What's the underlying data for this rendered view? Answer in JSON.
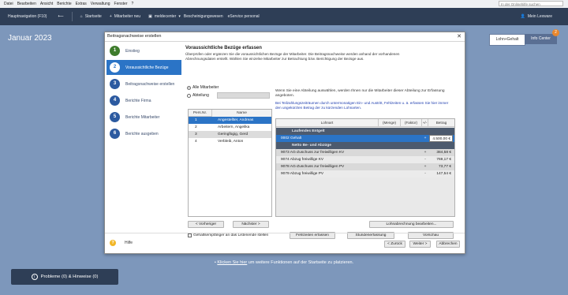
{
  "menu": [
    "Datei",
    "Bearbeiten",
    "Ansicht",
    "Berichte",
    "Extras",
    "Verwaltung",
    "Fenster",
    "?"
  ],
  "search_placeholder": "In der Onlinehilfe suchen",
  "nav": {
    "hauptnavigation": "Hauptnavigation (F10)",
    "startseite": "Startseite",
    "mitarbeiter_neu": "Mitarbeiter neu",
    "meldecenter": "meldecenter",
    "bescheinigungswesen": "Bescheinigungswesen",
    "eservice": "eService personal",
    "mein_lexware": "Mein Lexware"
  },
  "page": {
    "title": "Januar 2023",
    "tab_lohn": "Lohn+Gehalt",
    "tab_info": "Info Center",
    "info_badge": "2"
  },
  "dialog": {
    "title": "Beitragsnachweise erstellen",
    "steps": [
      {
        "num": "1",
        "label": "Einstieg",
        "state": "done"
      },
      {
        "num": "2",
        "label": "Voraussichtliche Bezüge",
        "state": "active"
      },
      {
        "num": "3",
        "label": "Beitragsnachweise erstellen",
        "state": "todo"
      },
      {
        "num": "4",
        "label": "Berichte Firma",
        "state": "todo"
      },
      {
        "num": "5",
        "label": "Berichte Mitarbeiter",
        "state": "todo"
      },
      {
        "num": "6",
        "label": "Berichte ausgeben",
        "state": "todo"
      }
    ],
    "heading": "Voraussichtliche Bezüge erfassen",
    "intro": "Überprüfen oder ergänzen Sie die voraussichtlichen Bezüge der  Mitarbeiter. Die Beitragsnachweise werden anhand der vorhandenen Abrechnungsdaten erstellt. Wählen Sie einzelne Mitarbeiter zur Betrachtung bzw. Berichtigung der Bezüge aus.",
    "radio_alle": "Alle Mitarbeiter",
    "radio_abteilung": "Abteilung",
    "emp_headers": [
      "Pers.Nr.",
      "Name"
    ],
    "employees": [
      {
        "nr": "1",
        "name": "Angestellter, Andreas"
      },
      {
        "nr": "2",
        "name": "Arbeitern, Angelika"
      },
      {
        "nr": "3",
        "name": "Geringfügig, Gerd"
      },
      {
        "nr": "4",
        "name": "Verbleib, Anton"
      }
    ],
    "btn_prev": "< Vorheriger",
    "btn_next": "Nächster >",
    "chk_gehalt": "Gehaltsempfänger an das Listenende stellen",
    "right_info": "Wenn Sie eine Abteilung auswählen, werden Ihnen nur die Mitarbeiter dieser Abteilung zur Erfassung angeboten.",
    "blue_hint": "Bei Teilzahlungszeiträumen durch untermonatigen Ein- und Austritt, Fehlzeiten u. ä. erfassen Sie hier immer den ungekürzten Betrag der zu kürzenden Lohnarten.",
    "grid_headers": [
      "Lohnart",
      "(Menge)",
      "(Faktor)",
      "+/-",
      "Betrag"
    ],
    "grid_rows": [
      {
        "type": "sec",
        "label": "Laufendes Entgelt",
        "sign": "",
        "amount": ""
      },
      {
        "type": "sel",
        "label": "0002 Gehalt",
        "sign": "+",
        "amount": "4.500,00 €"
      },
      {
        "type": "sec",
        "label": "Netto Be- und Abzüge",
        "sign": "",
        "amount": ""
      },
      {
        "type": "alt",
        "label": "9073 AG-Zuschuss zur freiwilligen KV",
        "sign": "+",
        "amount": "384,58 €"
      },
      {
        "type": "alt2",
        "label": "9074 Abzug freiwillige KV",
        "sign": "-",
        "amount": "769,17 €"
      },
      {
        "type": "alt",
        "label": "9078 AG-Zuschuss zur freiwilligen PV",
        "sign": "+",
        "amount": "73,77 €"
      },
      {
        "type": "alt2",
        "label": "9079 Abzug freiwillige PV",
        "sign": "-",
        "amount": "147,54 €"
      }
    ],
    "btn_lohnberechnung": "Lohnabrechnung bearbeiten...",
    "btn_fehlzeiten": "Fehlzeiten erfassen",
    "btn_stunden": "Stundenerfassung",
    "btn_vorschau": "Vorschau",
    "help_label": "Hilfe",
    "btn_back": "< Zurück",
    "btn_forward": "Weiter >",
    "btn_cancel": "Abbrechen"
  },
  "bottom": {
    "hint_prefix": "• ",
    "hint_link": "Klicken Sie hier",
    "hint_rest": " um weitere Funktionen auf der Startseite zu platzieren.",
    "problems": "Probleme (0) & Hinweise (0)"
  }
}
